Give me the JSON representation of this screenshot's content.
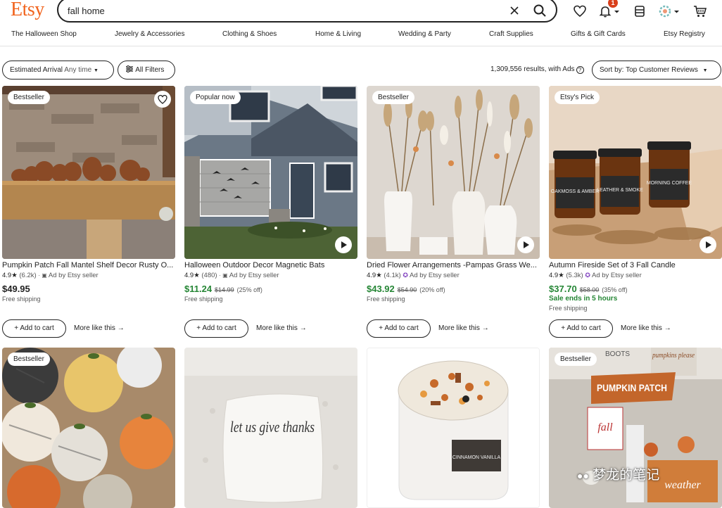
{
  "logo": "Etsy",
  "search": {
    "query": "fall home"
  },
  "header": {
    "notification_count": "1"
  },
  "nav": [
    "The Halloween Shop",
    "Jewelry & Accessories",
    "Clothing & Shoes",
    "Home & Living",
    "Wedding & Party",
    "Craft Supplies",
    "Gifts & Gift Cards",
    "Etsy Registry"
  ],
  "filters": {
    "arrival_label": "Estimated Arrival",
    "arrival_value": "Any time",
    "all_filters": "All Filters",
    "results": "1,309,556 results, with Ads",
    "sort_label": "Sort by:",
    "sort_value": "Top Customer Reviews"
  },
  "products": [
    {
      "badge": "Bestseller",
      "title": "Pumpkin Patch Fall Mantel Shelf Decor Rusty O...",
      "rating": "4.9",
      "reviews": "(6.2k)",
      "ad": "Ad by Etsy seller",
      "price": "$49.95",
      "original": "",
      "discount": "",
      "urgent": "",
      "shipping": "Free shipping",
      "cart": "Add to cart",
      "more": "More like this"
    },
    {
      "badge": "Popular now",
      "title": "Halloween Outdoor Decor Magnetic Bats",
      "rating": "4.9",
      "reviews": "(480)",
      "ad": "Ad by Etsy seller",
      "price": "$11.24",
      "original": "$14.99",
      "discount": "(25% off)",
      "urgent": "",
      "shipping": "Free shipping",
      "cart": "Add to cart",
      "more": "More like this"
    },
    {
      "badge": "Bestseller",
      "title": "Dried Flower Arrangements -Pampas Grass We...",
      "rating": "4.9",
      "reviews": "(4.1k)",
      "ad": "Ad by Etsy seller",
      "price": "$43.92",
      "original": "$54.90",
      "discount": "(20% off)",
      "urgent": "",
      "shipping": "Free shipping",
      "cart": "Add to cart",
      "more": "More like this"
    },
    {
      "badge": "Etsy's Pick",
      "title": "Autumn Fireside Set of 3 Fall Candle",
      "rating": "4.9",
      "reviews": "(5.3k)",
      "ad": "Ad by Etsy seller",
      "price": "$37.70",
      "original": "$58.00",
      "discount": "(35% off)",
      "urgent": "Sale ends in 5 hours",
      "shipping": "Free shipping",
      "cart": "Add to cart",
      "more": "More like this"
    }
  ],
  "row2": [
    {
      "badge": "Bestseller"
    },
    {
      "badge": ""
    },
    {
      "badge": ""
    },
    {
      "badge": "Bestseller"
    }
  ],
  "image_text": {
    "candle_labels": [
      "OAKMOSS & AMBER",
      "LEATHER & SMOKE",
      "MORNING COFFEE"
    ],
    "pillow_text": "let us give thanks",
    "candle_jar_label": "CINNAMON VANILLA",
    "sign_boots": "BOOTS",
    "sign_pumpkins": "pumpkins please",
    "sign_patch": "PUMPKIN PATCH",
    "sign_fall": "fall",
    "sign_weather": "weather",
    "watermark": "梦龙的笔记"
  },
  "colors": {
    "brand": "#F1641E",
    "sale": "#258635",
    "badge": "#D93F1B"
  }
}
